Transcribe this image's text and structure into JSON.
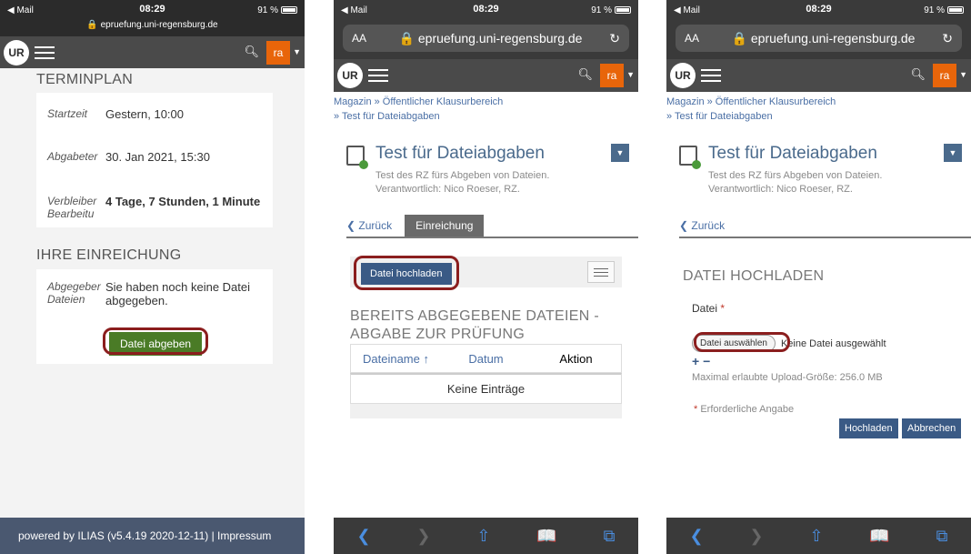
{
  "status": {
    "carrier": "◀ Mail",
    "time": "08:29",
    "battery": "91 %"
  },
  "phone1": {
    "url": "epruefung.uni-regensburg.de",
    "terminplan_title": "TERMINPLAN",
    "rows": [
      {
        "key": "Startzeit",
        "value": "Gestern, 10:00"
      },
      {
        "key": "Abgabeter",
        "value": "30. Jan 2021, 15:30"
      },
      {
        "key": "Verbleiber Bearbeitu",
        "value": "4 Tage, 7 Stunden, 1 Minute"
      }
    ],
    "einreichung_title": "IHRE EINREICHUNG",
    "abgabe_key": "Abgegeber Dateien",
    "abgabe_value": "Sie haben noch keine Datei abgegeben.",
    "abgabe_button": "Datei abgeben",
    "footer": "powered by ILIAS (v5.4.19 2020-12-11) | Impressum"
  },
  "safari": {
    "aa": "AA",
    "domain": "epruefung.uni-regensburg.de",
    "lock": "🔒"
  },
  "nav": {
    "logo": "UR",
    "user": "ra"
  },
  "breadcrumb": {
    "line1": "Magazin  »  Öffentlicher Klausurbereich",
    "line2": "»  Test für Dateiabgaben"
  },
  "object": {
    "title": "Test für Dateiabgaben",
    "subtitle1": "Test des RZ fürs Abgeben von Dateien.",
    "subtitle2": "Verantwortlich: Nico Roeser, RZ."
  },
  "phone2": {
    "back_tab": "Zurück",
    "active_tab": "Einreichung",
    "upload_button": "Datei hochladen",
    "section_title": "BEREITS ABGEGEBENE DATEIEN - ABGABE ZUR PRÜFUNG",
    "columns": [
      "Dateiname ↑",
      "Datum",
      "Aktion"
    ],
    "empty": "Keine Einträge"
  },
  "phone3": {
    "back_tab": "Zurück",
    "section_title": "DATEI HOCHLADEN",
    "field_label": "Datei",
    "choose_button": "Datei auswählen",
    "no_file": "Keine Datei ausgewählt",
    "plus_minus": "+  −",
    "max_size": "Maximal erlaubte Upload-Größe: 256.0 MB",
    "required_note": "Erforderliche Angabe",
    "submit_button": "Hochladen",
    "cancel_button": "Abbrechen"
  },
  "colors": {
    "accent_orange": "#e8650a",
    "ilias_blue": "#3a5a85",
    "green_button": "#4a7b26",
    "annotation_red": "#8b1e1e"
  }
}
